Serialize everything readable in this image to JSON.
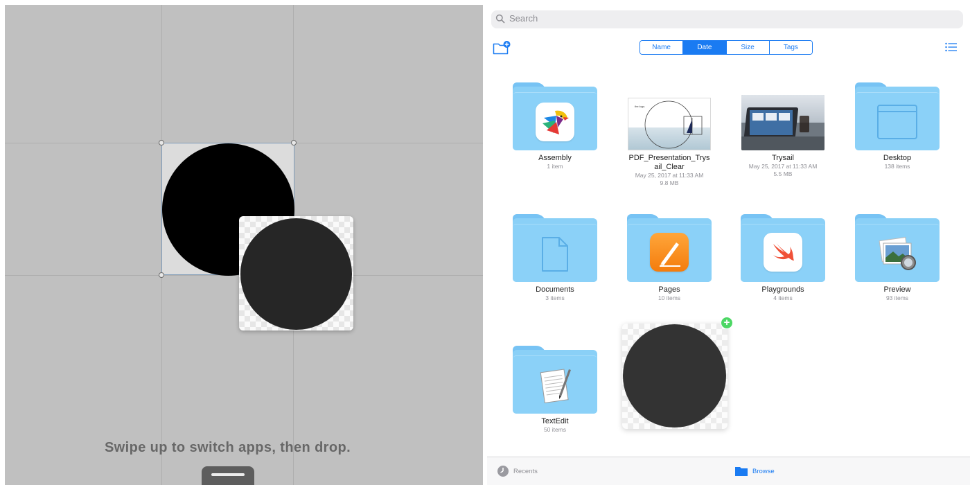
{
  "canvas": {
    "drag_hint": "Swipe up to switch apps, then drop."
  },
  "files": {
    "search": {
      "placeholder": "Search"
    },
    "sort": {
      "options": [
        "Name",
        "Date",
        "Size",
        "Tags"
      ],
      "selected": "Date"
    },
    "items": [
      {
        "title": "Assembly",
        "meta": [
          "1 item"
        ],
        "kind": "folder",
        "icon": "assembly-bird-icon"
      },
      {
        "title": "PDF_Presentation_Trysail_Clear",
        "meta": [
          "May 25, 2017 at 11:33 AM",
          "9.8 MB"
        ],
        "kind": "document",
        "thumb_caption": "the logo."
      },
      {
        "title": "Trysail",
        "meta": [
          "May 25, 2017 at 11:33 AM",
          "5.5 MB"
        ],
        "kind": "image"
      },
      {
        "title": "Desktop",
        "meta": [
          "138 items"
        ],
        "kind": "folder",
        "icon": "desktop-window-icon"
      },
      {
        "title": "Documents",
        "meta": [
          "3 items"
        ],
        "kind": "folder",
        "icon": "document-page-icon"
      },
      {
        "title": "Pages",
        "meta": [
          "10 items"
        ],
        "kind": "folder",
        "icon": "pages-app-icon"
      },
      {
        "title": "Playgrounds",
        "meta": [
          "4 items"
        ],
        "kind": "folder",
        "icon": "swift-playgrounds-icon"
      },
      {
        "title": "Preview",
        "meta": [
          "93 items"
        ],
        "kind": "folder",
        "icon": "preview-app-icon"
      },
      {
        "title": "TextEdit",
        "meta": [
          "50 items"
        ],
        "kind": "folder",
        "icon": "textedit-app-icon"
      }
    ],
    "tabs": {
      "recents": "Recents",
      "browse": "Browse"
    }
  },
  "colors": {
    "accent": "#1a7bf2",
    "folder": "#8bd1f8",
    "canvas_background": "#c0c0c0",
    "drop_badge": "#4cd764"
  }
}
